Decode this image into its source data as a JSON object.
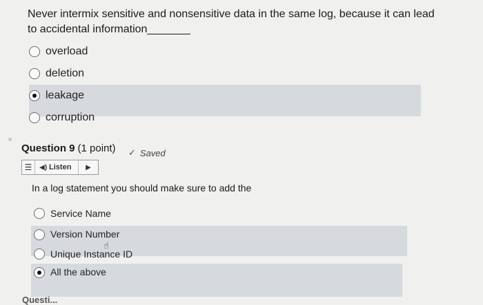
{
  "question8": {
    "text": "Never intermix sensitive and nonsensitive data in the same log, because it can lead to accidental information",
    "blank": "_______",
    "options": [
      "overload",
      "deletion",
      "leakage",
      "corruption"
    ],
    "selected_option": "leakage"
  },
  "question9": {
    "title": "Question 9",
    "points": "(1 point)",
    "saved_label": "Saved",
    "listen_label": "Listen",
    "text": "In a log statement you should make sure to add the",
    "options": [
      "Service Name",
      "Version Number",
      "Unique Instance ID",
      "All the above"
    ],
    "selected_option": "All the above"
  },
  "next_question_cut": "Questi...",
  "icons": {
    "check": "check-icon",
    "menu": "menu-icon",
    "speaker": "speaker-icon",
    "play": "play-icon",
    "cursor": "hand-cursor-icon"
  },
  "colors": {
    "background": "#f0f0ee",
    "highlight_row": "#d6dadf",
    "text": "#1f1f1f"
  }
}
